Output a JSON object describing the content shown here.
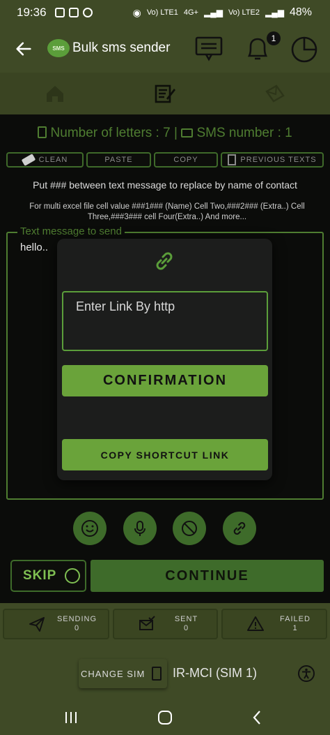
{
  "status_bar": {
    "time": "19:36",
    "net1": "Vo) LTE1",
    "net2": "4G+",
    "net3": "Vo) LTE2",
    "battery": "48%"
  },
  "app_bar": {
    "title": "Bulk sms sender",
    "logo_text": "SMS",
    "notification_count": "1"
  },
  "counter": {
    "letters_label": "Number of letters : 7",
    "separator": "|",
    "sms_label": "SMS number : 1"
  },
  "actions": {
    "clean": "CLEAN",
    "paste": "PASTE",
    "copy": "COPY",
    "previous": "PREVIOUS TEXTS"
  },
  "hints": {
    "line1": "Put ### between text message to replace by name of contact",
    "line2": "For multi excel file cell value ###1### (Name) Cell Two,###2### (Extra..) Cell Three,###3### cell Four(Extra..) And more..."
  },
  "message": {
    "legend": "Text message to send",
    "value": "hello.."
  },
  "dialog": {
    "input_placeholder": "Enter Link By http",
    "confirm_label": "CONFIRMATION",
    "shortcut_label": "COPY SHORTCUT LINK"
  },
  "buttons": {
    "skip": "SKIP",
    "continue": "CONTINUE"
  },
  "stats": {
    "sending_label": "SENDING",
    "sending_value": "0",
    "sent_label": "SENT",
    "sent_value": "0",
    "failed_label": "FAILED",
    "failed_value": "1"
  },
  "sim": {
    "change_label": "CHANGE SIM",
    "current": "IR-MCI (SIM 1)"
  },
  "colors": {
    "primary": "#3f4a26",
    "accent": "#6aa33a",
    "border_green": "#4f7d31"
  }
}
